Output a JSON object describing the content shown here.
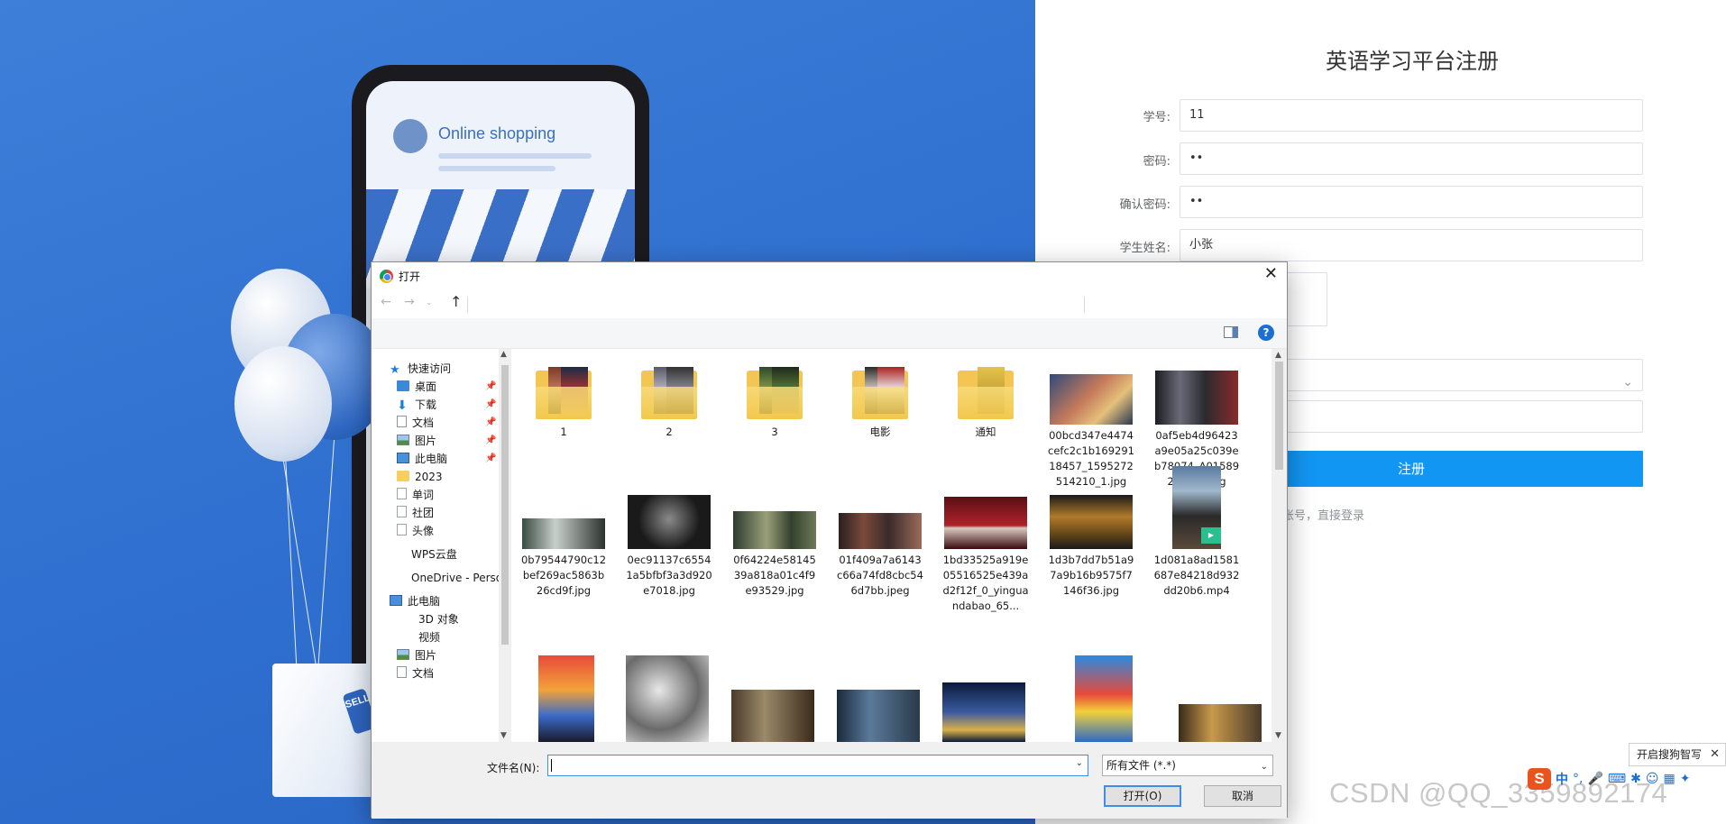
{
  "banner": {
    "phone_title": "Online shopping",
    "bag_tag": "SELL"
  },
  "registration": {
    "title": "英语学习平台注册",
    "fields": [
      {
        "label": "学号:",
        "value": "11"
      },
      {
        "label": "密码:",
        "value": "••"
      },
      {
        "label": "确认密码:",
        "value": "••"
      },
      {
        "label": "学生姓名:",
        "value": "小张"
      }
    ],
    "submit_label": "注册",
    "login_link": "账号，直接登录"
  },
  "dialog": {
    "title": "打开",
    "nav_pane": {
      "items": [
        {
          "label": "快速访问",
          "icon": "star-icon",
          "pinned": false
        },
        {
          "label": "桌面",
          "icon": "desktop-icon",
          "pinned": true
        },
        {
          "label": "下载",
          "icon": "download-icon",
          "pinned": true
        },
        {
          "label": "文档",
          "icon": "document-icon",
          "pinned": true
        },
        {
          "label": "图片",
          "icon": "picture-icon",
          "pinned": true
        },
        {
          "label": "此电脑",
          "icon": "computer-icon",
          "pinned": true
        },
        {
          "label": "2023",
          "icon": "folder-icon",
          "pinned": false
        },
        {
          "label": "单词",
          "icon": "file-icon",
          "pinned": false
        },
        {
          "label": "社团",
          "icon": "file-icon",
          "pinned": false
        },
        {
          "label": "头像",
          "icon": "file-icon",
          "pinned": false
        },
        {
          "label": "WPS云盘",
          "icon": "",
          "pinned": false
        },
        {
          "label": "OneDrive - Perso",
          "icon": "",
          "pinned": false
        },
        {
          "label": "此电脑",
          "icon": "computer-icon",
          "pinned": false
        },
        {
          "label": "3D 对象",
          "icon": "",
          "pinned": false
        },
        {
          "label": "视频",
          "icon": "",
          "pinned": false
        },
        {
          "label": "图片",
          "icon": "picture-icon",
          "pinned": false
        },
        {
          "label": "文档",
          "icon": "document-icon",
          "pinned": false
        }
      ]
    },
    "files": [
      {
        "name": "1",
        "kind": "folder"
      },
      {
        "name": "2",
        "kind": "folder"
      },
      {
        "name": "3",
        "kind": "folder"
      },
      {
        "name": "电影",
        "kind": "folder"
      },
      {
        "name": "通知",
        "kind": "folder"
      },
      {
        "name": "00bcd347e4474cefc2c1b16929118457_1595272514210_1.jpg",
        "kind": "image"
      },
      {
        "name": "0af5eb4d96423a9e05a25c039eb78074_A015892DJCH8.jpg",
        "kind": "image"
      },
      {
        "name": "0b79544790c12bef269ac5863b26cd9f.jpg",
        "kind": "image"
      },
      {
        "name": "0ec91137c65541a5bfbf3a3d920e7018.jpg",
        "kind": "image"
      },
      {
        "name": "0f64224e5814539a818a01c4f9e93529.jpg",
        "kind": "image"
      },
      {
        "name": "01f409a7a6143c66a74fd8cbc546d7bb.jpeg",
        "kind": "image"
      },
      {
        "name": "1bd33525a919e05516525e439ad2f12f_0_yinguandabao_65...",
        "kind": "image"
      },
      {
        "name": "1d3b7dd7b51a97a9b16b9575f7146f36.jpg",
        "kind": "image"
      },
      {
        "name": "1d081a8ad1581687e84218d932dd20b6.mp4",
        "kind": "video"
      }
    ],
    "file_name_label": "文件名(N):",
    "file_name_value": "",
    "file_type": "所有文件 (*.*)",
    "open_label": "打开(O)",
    "cancel_label": "取消"
  },
  "system": {
    "ime_hint": "开启搜狗智写",
    "ime_logo": "S",
    "ime_lang": "中",
    "watermark": "CSDN @QQ_3359892174"
  },
  "colors": {
    "banner_blue": "#2f6fcf",
    "primary_button": "#1296f3",
    "dialog_focus": "#3c8ee6"
  }
}
